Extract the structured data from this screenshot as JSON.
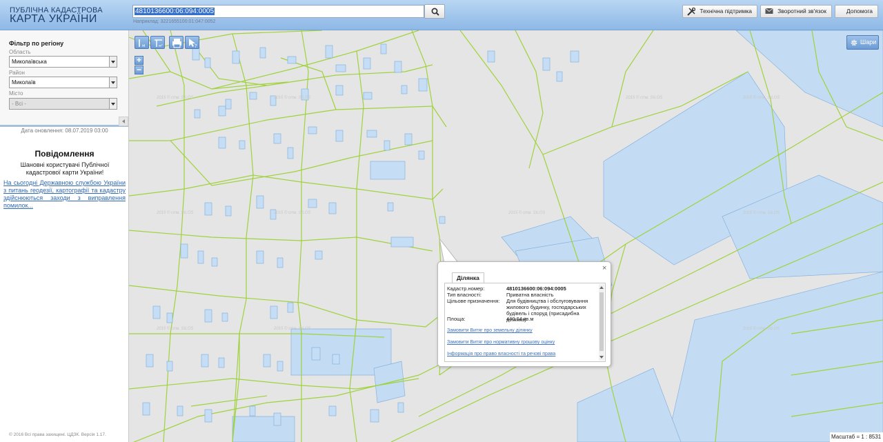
{
  "header": {
    "logo_top": "ПУБЛІЧНА КАДАСТРОВА",
    "logo_main": "КАРТА УКРАЇНИ",
    "search_value": "4810136600:06:094:0005",
    "search_hint": "Наприклад: 3221655100:01:047:0052",
    "support_label": "Технічна підтримка",
    "feedback_label": "Зворотний зв'язок",
    "help_label": "Допомога"
  },
  "sidebar": {
    "filter_title": "Фільтр по регіону",
    "oblast_label": "Область",
    "oblast_value": "Миколаївська",
    "rayon_label": "Район",
    "rayon_value": "Миколаїв",
    "misto_label": "Місто",
    "misto_value": "- Всі -",
    "update_date": "Дата оновлення: 08.07.2019 03:00",
    "notice_title": "Повідомлення",
    "notice_text": "Шановні користувачі Публічної кадастрової карти України!",
    "notice_link": "На сьогодні Державною службою України з питань геодезії, картографії та кадастру здійснюються заходи з виправлення помилок...",
    "copyright": "© 2016 Всі права захищені. ЦДЗК. Версія 1.17."
  },
  "map": {
    "layers_label": "Шари",
    "zoom_in": "+",
    "zoom_out": "−",
    "tool_1": "",
    "tool_2": "",
    "scale_label": "Масштаб = 1 : 8531",
    "watermark_text": "2015 © ств. SILOS"
  },
  "popup": {
    "tab_label": "Ділянка",
    "close": "×",
    "fields": [
      {
        "key": "Кадастр.номер:",
        "value": "4810136600:06:094:0005",
        "bold": true
      },
      {
        "key": "Тип власності:",
        "value": "Приватна власність"
      },
      {
        "key": "Цільове призначення:",
        "value": "Для будівництва і обслуговування жилового будинку, господарських будівель і споруд (присадибна ділянка)"
      },
      {
        "key": "Площа:",
        "value": "440.64 кв.м"
      }
    ],
    "links": [
      "Замовити Витяг про земельну ділянку",
      "Замовити Витяг про нормативну грошову оцінку",
      "Інформація про право власності та речові права"
    ]
  },
  "colors": {
    "header_bg": "#a7c8ee",
    "parcel_line": "#9fd23b",
    "building_fill": "#c2dcf2",
    "building_stroke": "#7aaad8",
    "link": "#2f68b5"
  }
}
